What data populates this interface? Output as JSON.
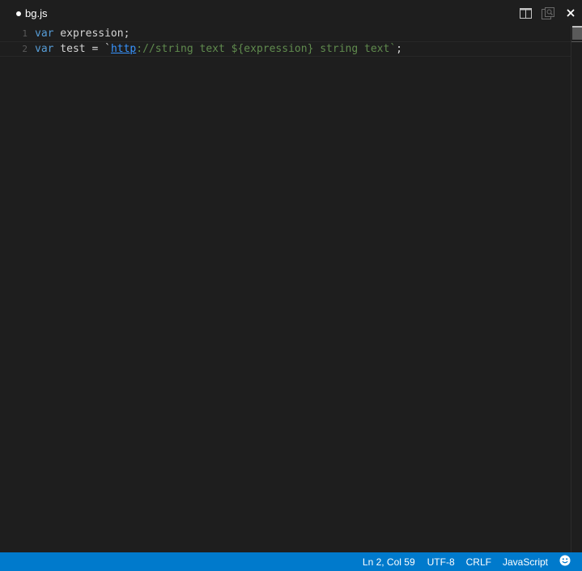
{
  "tab": {
    "filename": "bg.js",
    "dirty": true
  },
  "actions": {
    "icons": [
      "split-editor-icon",
      "open-changes-icon",
      "close-icon"
    ]
  },
  "editor": {
    "lines": [
      {
        "number": "1",
        "tokens": [
          "var",
          " expression;"
        ]
      },
      {
        "number": "2",
        "tokens": [
          "var",
          " test = `",
          "http",
          "://string text ${expression} string text`",
          ";"
        ]
      }
    ]
  },
  "statusbar": {
    "position": "Ln 2, Col 59",
    "encoding": "UTF-8",
    "eol": "CRLF",
    "language": "JavaScript",
    "feedback_icon": "smiley-icon"
  },
  "colors": {
    "background": "#1e1e1e",
    "keyword": "#569cd6",
    "string": "#608b4e",
    "link": "#3794ff",
    "line_number": "#5a5a5a",
    "statusbar": "#007acc"
  }
}
